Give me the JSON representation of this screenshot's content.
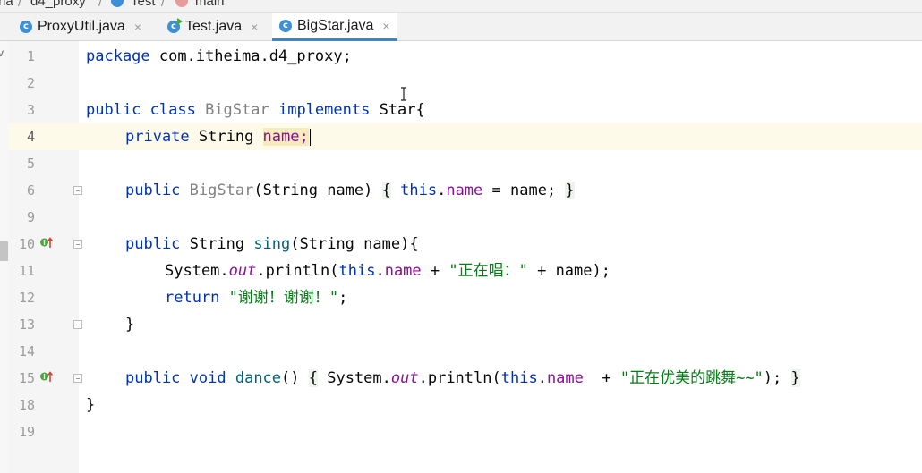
{
  "breadcrumb": {
    "items": [
      "na",
      "d4_proxy",
      "Test",
      "main"
    ]
  },
  "tabs": [
    {
      "label": "ProxyUtil.java",
      "close": "×",
      "active": false
    },
    {
      "label": "Test.java",
      "close": "×",
      "active": false
    },
    {
      "label": "BigStar.java",
      "close": "×",
      "active": true
    }
  ],
  "left_strip_label": "v",
  "editor": {
    "line_numbers": [
      "1",
      "2",
      "3",
      "4",
      "5",
      "6",
      "9",
      "10",
      "11",
      "12",
      "13",
      "14",
      "15",
      "18",
      "19"
    ],
    "current_line": "4",
    "code": {
      "l1_kw": "package",
      "l1_rest": " com.itheima.d4_proxy;",
      "l3_kw1": "public class",
      "l3_name": "BigStar",
      "l3_kw2": "implements",
      "l3_rest": " Star{",
      "l4_kw": "private",
      "l4_type": " String ",
      "l4_field": "name",
      "l4_semi": ";",
      "l6_kw": "public",
      "l6_name": "BigStar",
      "l6_args": "(String name) ",
      "l6_ob": "{",
      "l6_this": "this",
      "l6_dot": ".",
      "l6_field": "name",
      "l6_rest": " = name; ",
      "l6_cb": "}",
      "l10_kw": "public",
      "l10_type": " String ",
      "l10_meth": "sing",
      "l10_rest": "(String name){",
      "l11_pre": "System.",
      "l11_out": "out",
      "l11_mid": ".println(",
      "l11_this": "this",
      "l11_dot": ".",
      "l11_field": "name",
      "l11_plus": " + ",
      "l11_str": "\"正在唱：\"",
      "l11_rest": " + name);",
      "l12_kw": "return",
      "l12_str": "\"谢谢！谢谢！\"",
      "l12_semi": ";",
      "l13": "}",
      "l15_kw": "public void",
      "l15_meth": "dance",
      "l15_paren": "() ",
      "l15_ob": "{",
      "l15_pre": " System.",
      "l15_out": "out",
      "l15_mid": ".println(",
      "l15_this": "this",
      "l15_dot": ".",
      "l15_field": "name",
      "l15_plus": "  + ",
      "l15_str": "\"正在优美的跳舞~~\"",
      "l15_rest": "); ",
      "l15_cb": "}",
      "l18": "}"
    }
  },
  "colors": {
    "keyword": "#0033b3",
    "field": "#871094",
    "string": "#067d17",
    "method": "#00627a",
    "tab_underline": "#4083c9"
  }
}
